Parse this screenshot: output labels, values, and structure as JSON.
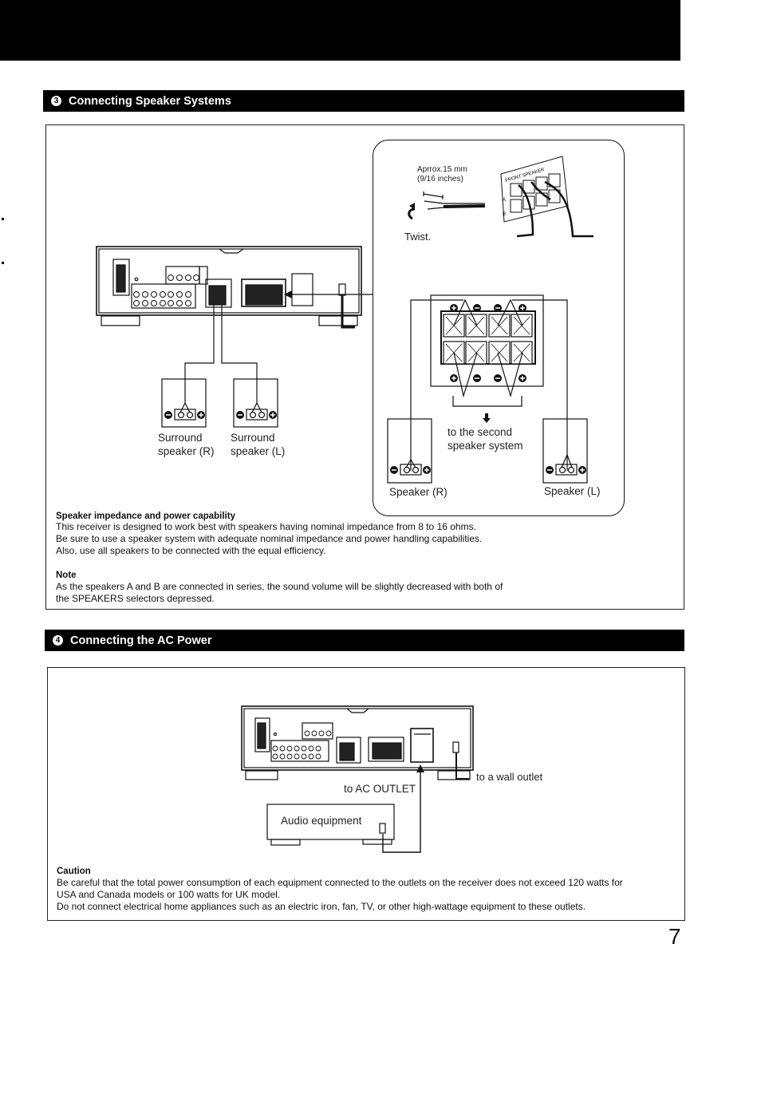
{
  "section3": {
    "number": "3",
    "title": "Connecting Speaker Systems",
    "inset": {
      "strip_length": "Aprrox.15 mm",
      "strip_length_inches": "(9/16 inches)",
      "twist_label": "Twist.",
      "panel_label": "FRONT SPEAKER",
      "row_a": "A",
      "row_b": "B",
      "second_system": "to the second speaker system",
      "second_system_line1": "to the second",
      "second_system_line2": "speaker system",
      "speaker_r": "Speaker (R)",
      "speaker_l": "Speaker (L)"
    },
    "surround_r_line1": "Surround",
    "surround_r_line2": "speaker (R)",
    "surround_l_line1": "Surround",
    "surround_l_line2": "speaker (L)",
    "impedance_heading": "Speaker impedance and power capability",
    "impedance_lines": [
      "This receiver is designed to work best with speakers having nominal impedance from 8 to 16 ohms.",
      "Be sure to use a speaker system with adequate nominal impedance and power handling capabilities.",
      "Also, use all speakers to be connected with the equal efficiency."
    ],
    "note_heading": "Note",
    "note_lines": [
      "As the speakers A and B are connected in series, the sound volume will be slightly decreased with both of",
      "the SPEAKERS selectors depressed."
    ]
  },
  "section4": {
    "number": "4",
    "title": "Connecting the AC Power",
    "wall_outlet": "to a wall outlet",
    "ac_outlet": "to AC OUTLET",
    "audio_equipment": "Audio equipment",
    "caution_heading": "Caution",
    "caution_lines": [
      "Be careful that the total power consumption of each equipment connected to the outlets on the receiver does not exceed 120 watts for",
      "USA and Canada models or 100 watts for UK model.",
      "Do not connect electrical home appliances such as an electric iron, fan, TV, or other high-wattage equipment to these outlets."
    ]
  },
  "page_number": "7"
}
